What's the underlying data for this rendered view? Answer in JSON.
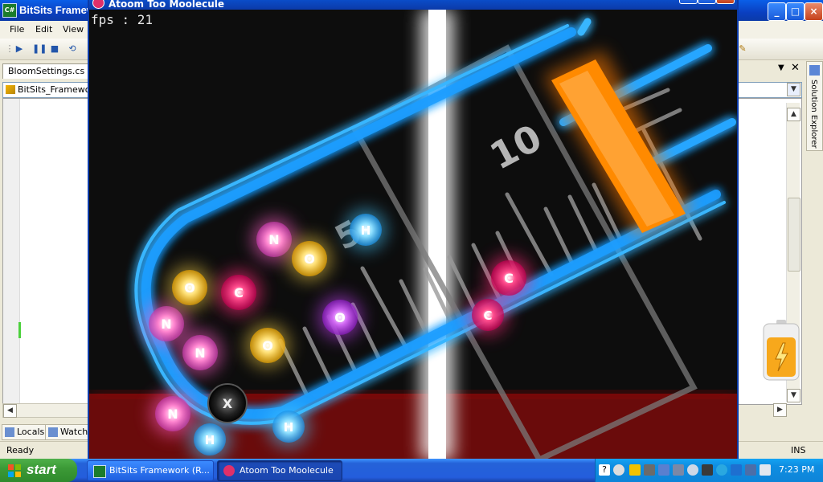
{
  "ide": {
    "title": "BitSits Framework",
    "menu": [
      "File",
      "Edit",
      "View"
    ],
    "doc_tab": "BloomSettings.cs",
    "class_combo": "BitSits_Framework",
    "bottom_tabs": [
      "Locals",
      "Watch"
    ],
    "status_left": "Ready",
    "status_right": "INS",
    "side_tab": "Solution Explorer",
    "win_buttons": [
      "_",
      "□",
      "×"
    ]
  },
  "game": {
    "window_title": "Atoom Too Moolecule",
    "fps_label": "fps : 21",
    "score_mark": "10",
    "colors": {
      "tube": "#1fa0ff",
      "plank": "#ff8c00",
      "pink": "#ff2d8a",
      "violet": "#c040f0",
      "yellow": "#ffd84a",
      "cyan": "#45c8ff",
      "black": "#1a1a1a"
    },
    "atoms": [
      {
        "name": "atom-n-pink-1",
        "letter": "N",
        "color": "pink"
      },
      {
        "name": "atom-n-pink-2",
        "letter": "N",
        "color": "pink"
      },
      {
        "name": "atom-n-pink-3",
        "letter": "N",
        "color": "pink"
      },
      {
        "name": "atom-n-pink-4",
        "letter": "N",
        "color": "pink"
      },
      {
        "name": "atom-c-red-1",
        "letter": "C",
        "color": "pink"
      },
      {
        "name": "atom-c-red-2",
        "letter": "C",
        "color": "pink"
      },
      {
        "name": "atom-o-violet",
        "letter": "O",
        "color": "violet"
      },
      {
        "name": "atom-o-yellow-1",
        "letter": "O",
        "color": "yellow"
      },
      {
        "name": "atom-o-yellow-2",
        "letter": "O",
        "color": "yellow"
      },
      {
        "name": "atom-o-yellow-3",
        "letter": "O",
        "color": "yellow"
      },
      {
        "name": "atom-h-cyan-1",
        "letter": "H",
        "color": "cyan"
      },
      {
        "name": "atom-h-cyan-2",
        "letter": "H",
        "color": "cyan"
      },
      {
        "name": "atom-h-cyan-3",
        "letter": "H",
        "color": "cyan"
      },
      {
        "name": "atom-x-black",
        "letter": "X",
        "color": "black"
      },
      {
        "name": "atom-c-pink-low",
        "letter": "C",
        "color": "pink"
      }
    ]
  },
  "taskbar": {
    "start": "start",
    "tasks": [
      "BitSits Framework (R...",
      "Atoom Too Moolecule"
    ],
    "clock": "7:23 PM"
  }
}
